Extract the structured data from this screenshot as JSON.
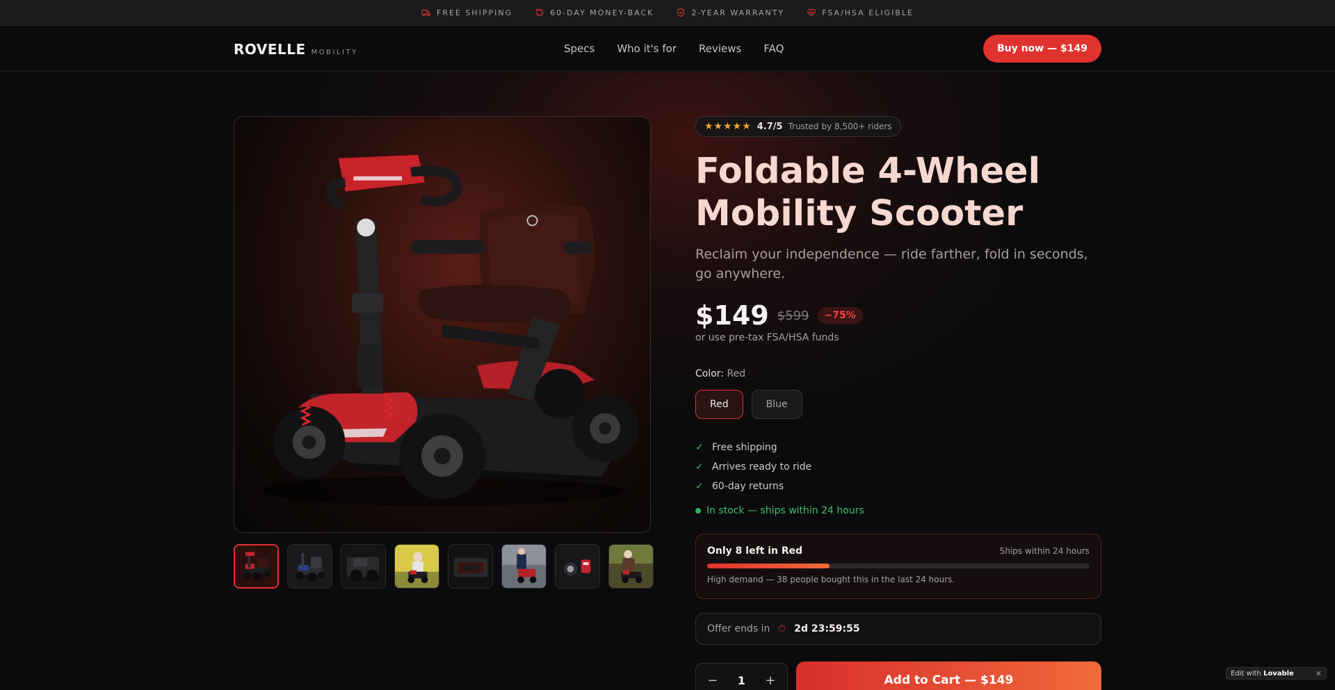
{
  "announcement": {
    "items": [
      {
        "label": "FREE SHIPPING",
        "icon": "truck-icon"
      },
      {
        "label": "60-DAY MONEY-BACK",
        "icon": "refresh-icon"
      },
      {
        "label": "2-YEAR WARRANTY",
        "icon": "shield-icon"
      },
      {
        "label": "FSA/HSA ELIGIBLE",
        "icon": "heart-icon"
      }
    ]
  },
  "header": {
    "brand": "ROVELLE",
    "brand_sub": "MOBILITY",
    "nav": [
      "Specs",
      "Who it's for",
      "Reviews",
      "FAQ"
    ],
    "cta": "Buy now — $149"
  },
  "product": {
    "rating_stars": "★★★★★",
    "rating": "4.7/5",
    "trust": "Trusted by 8,500+ riders",
    "title": "Foldable 4-Wheel Mobility Scooter",
    "subtitle": "Reclaim your independence — ride farther, fold in seconds, go anywhere.",
    "price": "$149",
    "old_price": "$599",
    "discount": "−75%",
    "fsa_note": "or use pre-tax FSA/HSA funds",
    "color_label": "Color:",
    "color_selected": "Red",
    "colors": [
      "Red",
      "Blue"
    ],
    "benefits": [
      "Free shipping",
      "Arrives ready to ride",
      "60-day returns"
    ],
    "stock": "In stock — ships within 24 hours",
    "thumbnail_count": 8
  },
  "scarcity": {
    "title": "Only 8 left in Red",
    "ships": "Ships within 24 hours",
    "stock_fraction": 0.32,
    "note": "High demand — 38 people bought this in the last 24 hours."
  },
  "offer": {
    "label": "Offer ends in",
    "time": "2d 23:59:55"
  },
  "cart": {
    "quantity": "1",
    "minus": "−",
    "plus": "+",
    "button": "Add to Cart — $149"
  },
  "badge": {
    "text": "Edit with",
    "brand": "Lovable",
    "close": "✕"
  },
  "colors": {
    "accent": "#e0332f",
    "success": "#3fbf6a",
    "background": "#0b0b0d",
    "title": "#f6d8d0"
  }
}
